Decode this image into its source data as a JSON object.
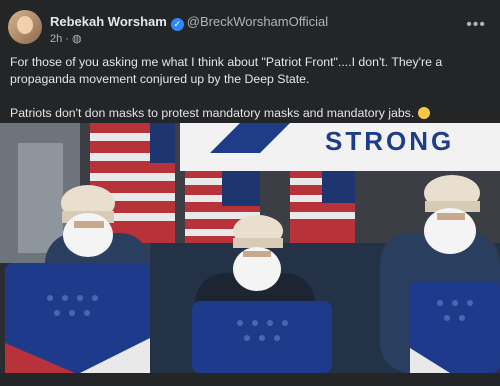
{
  "post": {
    "author_name": "Rebekah Worsham",
    "handle": "@BreckWorshamOfficial",
    "time": "2h",
    "privacy_icon": "globe-icon",
    "more_label": "•••",
    "paragraph1": "For those of you asking me what I think about \"Patriot Front\"....I don't. They're a propaganda movement conjured up by the Deep State.",
    "paragraph2": "Patriots don't don masks to protest mandatory masks and mandatory jabs.",
    "emoji": "flushed-face-emoji"
  },
  "photo": {
    "banner_text": "STRONG",
    "colors": {
      "banner": "#f2f2f2",
      "banner_text": "#1f3c88",
      "shield": "#1e3a8a",
      "jacket": "#2a3f5f",
      "mask": "#f4f4f4",
      "cap": "#e9dfcf"
    }
  }
}
